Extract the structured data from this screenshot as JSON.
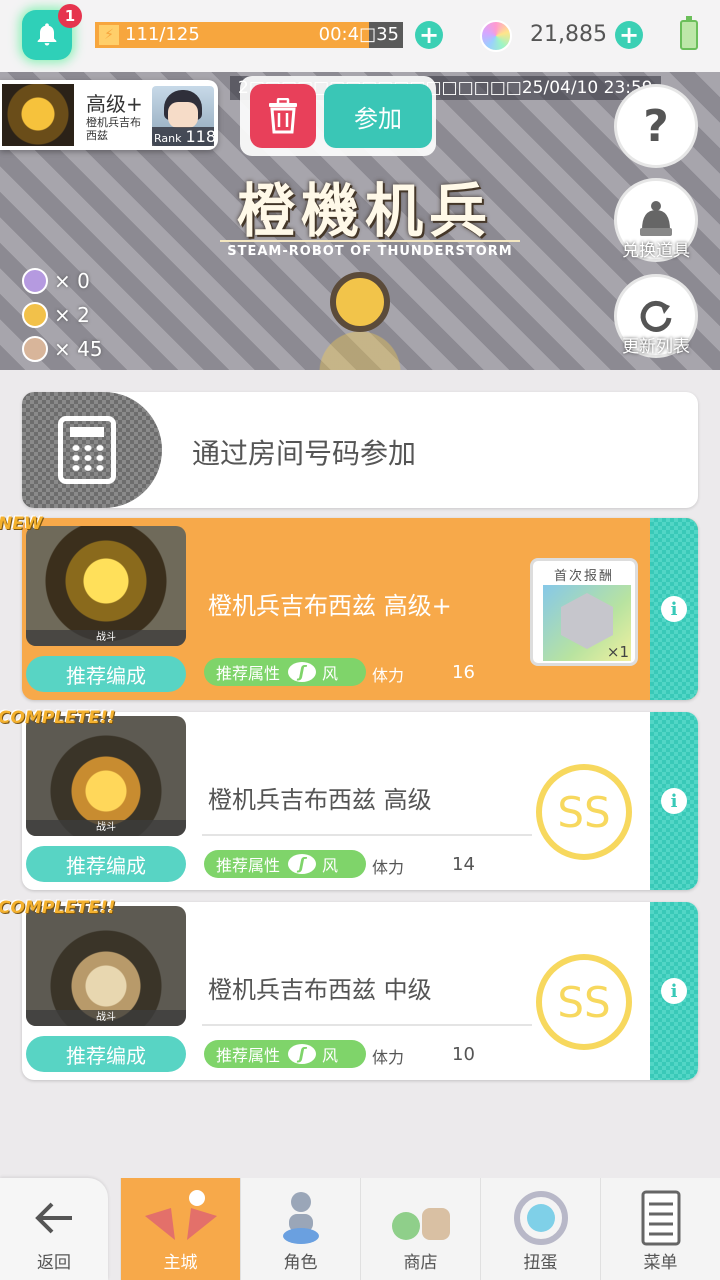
{
  "status_bar": {
    "notification_count": "1",
    "stamina_text": "111/125",
    "stamina_timer": "00:4□35",
    "stamina_fraction": 0.888,
    "gem_count": "21,885"
  },
  "banner": {
    "date_range": "2□□□□□□□□□□□□□□□□□25/04/10 23:59",
    "logo_text": "橙機机兵",
    "subtitle": "STEAM-ROBOT OF THUNDERSTORM",
    "currency": [
      {
        "count": "× 0"
      },
      {
        "count": "× 2"
      },
      {
        "count": "× 45"
      }
    ],
    "help_symbol": "?",
    "exchange_label": "兑换道具",
    "refresh_label": "更新列表"
  },
  "recruit": {
    "difficulty": "高级+",
    "boss_name": "橙机兵吉布西兹",
    "rank_label": "Rank",
    "rank_value": "118",
    "join_label": "参加"
  },
  "room_join": {
    "label": "通过房间号码参加"
  },
  "quests": [
    {
      "tag": "NEW",
      "thumb_label": "战斗",
      "name": "橙机兵吉布西兹 高级+",
      "recommend_label": "推荐编成",
      "attr_label": "推荐属性",
      "attr_value": "风",
      "stamina_label": "体力",
      "stamina_cost": "16",
      "reward_caption": "首次报酬",
      "reward_qty": "×1"
    },
    {
      "tag": "COMPLETE!!",
      "thumb_label": "战斗",
      "name": "橙机兵吉布西兹 高级",
      "recommend_label": "推荐编成",
      "attr_label": "推荐属性",
      "attr_value": "风",
      "stamina_label": "体力",
      "stamina_cost": "14",
      "rank": "SS"
    },
    {
      "tag": "COMPLETE!!",
      "thumb_label": "战斗",
      "name": "橙机兵吉布西兹 中级",
      "recommend_label": "推荐编成",
      "attr_label": "推荐属性",
      "attr_value": "风",
      "stamina_label": "体力",
      "stamina_cost": "10",
      "rank": "SS"
    }
  ],
  "nav": {
    "back": "返回",
    "items": [
      {
        "label": "主城",
        "active": true
      },
      {
        "label": "角色",
        "active": false
      },
      {
        "label": "商店",
        "active": false
      },
      {
        "label": "扭蛋",
        "active": false
      },
      {
        "label": "菜单",
        "active": false
      }
    ]
  }
}
